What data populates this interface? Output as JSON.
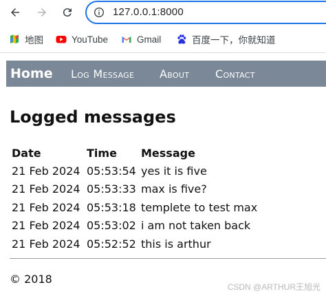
{
  "browser": {
    "url": "127.0.0.1:8000",
    "bookmarks": [
      {
        "label": "地图",
        "icon": "maps-icon"
      },
      {
        "label": "YouTube",
        "icon": "youtube-icon"
      },
      {
        "label": "Gmail",
        "icon": "gmail-icon"
      },
      {
        "label": "百度一下，你就知道",
        "icon": "baidu-icon"
      }
    ]
  },
  "nav": {
    "home": "Home",
    "log_message": "Log Message",
    "about": "About",
    "contact": "Contact",
    "bar_color": "#7a8898"
  },
  "page": {
    "title": "Logged messages",
    "columns": [
      "Date",
      "Time",
      "Message"
    ],
    "rows": [
      {
        "date": "21 Feb 2024",
        "time": "05:53:54",
        "message": "yes it is five"
      },
      {
        "date": "21 Feb 2024",
        "time": "05:53:33",
        "message": "max is five?"
      },
      {
        "date": "21 Feb 2024",
        "time": "05:53:18",
        "message": "templete to test max"
      },
      {
        "date": "21 Feb 2024",
        "time": "05:53:02",
        "message": "i am not taken back"
      },
      {
        "date": "21 Feb 2024",
        "time": "05:52:52",
        "message": "this is arthur"
      }
    ],
    "footer": "© 2018"
  },
  "watermark": "CSDN @ARTHUR王旭光"
}
